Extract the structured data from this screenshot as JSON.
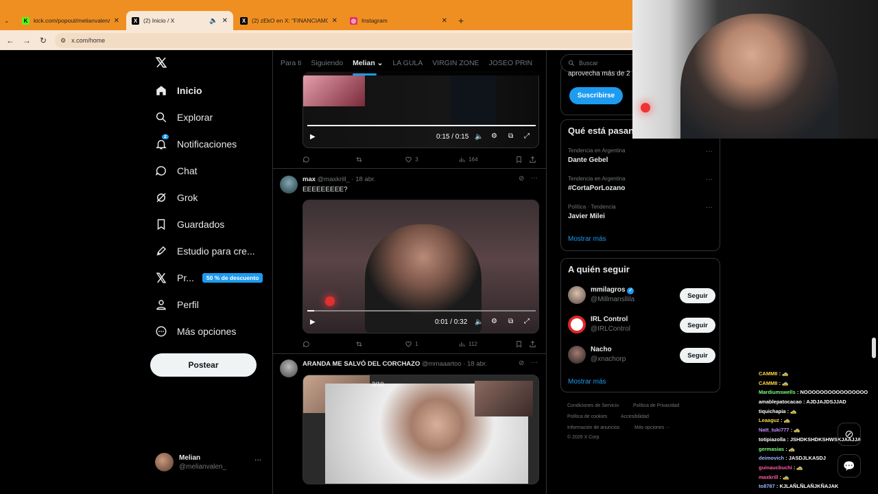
{
  "browser": {
    "tabs": [
      {
        "label": "kick.com/popout/melianvalen/c",
        "favicon": "K",
        "favicon_color": "#53fc18"
      },
      {
        "label": "(2) Inicio / X",
        "favicon": "X",
        "favicon_color": "#000000"
      },
      {
        "label": "(2) zEkO en X: \"FINANCIAMOS",
        "favicon": "X",
        "favicon_color": "#000000"
      },
      {
        "label": "Instagram",
        "favicon": "◎",
        "favicon_color": "#e1306c"
      }
    ],
    "new_tab": "+",
    "url": "x.com/home"
  },
  "sidebar": {
    "logo": "X",
    "items": [
      {
        "label": "Inicio",
        "icon": "home-icon"
      },
      {
        "label": "Explorar",
        "icon": "search-icon"
      },
      {
        "label": "Notificaciones",
        "icon": "bell-icon",
        "badge": "2"
      },
      {
        "label": "Chat",
        "icon": "chat-icon"
      },
      {
        "label": "Grok",
        "icon": "grok-icon"
      },
      {
        "label": "Guardados",
        "icon": "bookmark-icon"
      },
      {
        "label": "Estudio para cre...",
        "icon": "rocket-icon"
      },
      {
        "label": "Pr...",
        "icon": "x-premium-icon",
        "promo": "50 % de descuento"
      },
      {
        "label": "Perfil",
        "icon": "person-icon"
      },
      {
        "label": "Más opciones",
        "icon": "more-circle-icon"
      }
    ],
    "post_button": "Postear",
    "account": {
      "name": "Melian",
      "handle": "@melianvalen_",
      "more": "···"
    }
  },
  "feed": {
    "tabs": [
      "Para ti",
      "Siguiendo",
      "Melian",
      "LA GULA",
      "VIRGIN ZONE",
      "JOSEO PRIN"
    ],
    "selected_tab": "Melian",
    "posts": [
      {
        "video_time": "0:15 / 0:15",
        "progress": 1.0,
        "stats": {
          "replies": "",
          "reposts": "",
          "likes": "3",
          "views": "164"
        }
      },
      {
        "name": "max",
        "handle": "@maxkrill_",
        "date": "· 18 abr.",
        "text": "EEEEEEEEE?",
        "video_time": "0:01 / 0:32",
        "progress": 0.03,
        "stats": {
          "replies": "",
          "reposts": "",
          "likes": "1",
          "views": "112"
        }
      },
      {
        "name": "ARANDA ME SALVÓ DEL CORCHAZO",
        "handle": "@mmaaartoo",
        "date": "· 18 abr.",
        "counter": "3/10"
      }
    ]
  },
  "right": {
    "search_placeholder": "Buscar",
    "premium_text": "aprovecha más de 2",
    "subscribe": "Suscribirse",
    "trends_title": "Qué está pasan",
    "trends": [
      {
        "context": "Tendencia en Argentina",
        "name": "Dante Gebel"
      },
      {
        "context": "Tendencia en Argentina",
        "name": "#CortaPorLozano"
      },
      {
        "context": "Política · Tendencia",
        "name": "Javier Milei"
      }
    ],
    "show_more": "Mostrar más",
    "who_title": "A quién seguir",
    "who": [
      {
        "name": "mmilagros",
        "handle": "@Millmansllila",
        "verified": true
      },
      {
        "name": "IRL Control",
        "handle": "@IRLControl",
        "verified": false
      },
      {
        "name": "Nacho",
        "handle": "@xnachorp",
        "verified": false
      }
    ],
    "follow_label": "Seguir",
    "show_more2": "Mostrar más",
    "footer": [
      "Condiciones de Servicio",
      "Política de Privacidad",
      "Política de cookies",
      "Accesibilidad",
      "Información de anuncios",
      "Más opciones ···",
      "© 2026 X Corp."
    ]
  },
  "chat": [
    {
      "user": "CAMMII",
      "msg": "🚕",
      "color": "#ffd84a"
    },
    {
      "user": "CAMMII",
      "msg": "🚕",
      "color": "#ffd84a"
    },
    {
      "user": "Mardiumswells",
      "msg": "NOOOOOOOOOOOOOOOO",
      "color": "#7cff7c"
    },
    {
      "user": "amablepatocacao",
      "msg": "AJDJAJDSJJAD",
      "color": "#ffffff"
    },
    {
      "user": "tiquichapia",
      "msg": "🚕",
      "color": "#ffffff"
    },
    {
      "user": "Leaaguz",
      "msg": "🚕",
      "color": "#ffd84a"
    },
    {
      "user": "Natt_tuki777",
      "msg": "🚕",
      "color": "#c78bff"
    },
    {
      "user": "totipiazolla",
      "msg": "JSHDKSHDKSHWSKJAAJJA",
      "color": "#ffffff"
    },
    {
      "user": "germasias",
      "msg": "🚕",
      "color": "#7cff7c"
    },
    {
      "user": "deimovich",
      "msg": "JASDJLKASDJ",
      "color": "#9ab8ff"
    },
    {
      "user": "guinaucbuchi",
      "msg": "🚕",
      "color": "#ff5ca8"
    },
    {
      "user": "maxkrill",
      "msg": "🚕",
      "color": "#ff5ca8"
    },
    {
      "user": "to8787",
      "msg": "KJLAÑLÑLAÑJKÑAJAK",
      "color": "#9ab8ff"
    }
  ]
}
